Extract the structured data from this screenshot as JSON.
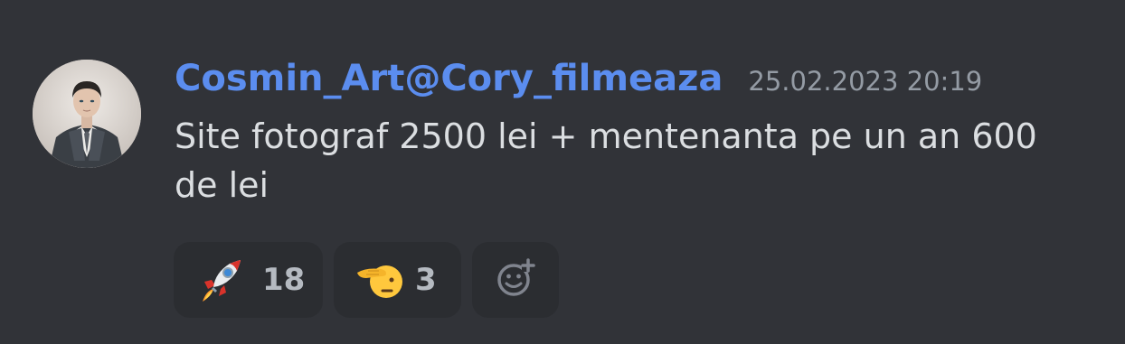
{
  "message": {
    "username": "Cosmin_Art@Cory_filmeaza",
    "timestamp": "25.02.2023 20:19",
    "content": "Site fotograf 2500 lei + mentenanta pe un an 600 de lei"
  },
  "reactions": [
    {
      "emoji": "rocket-emoji",
      "count": "18"
    },
    {
      "emoji": "saluting-face-emoji",
      "count": "3"
    }
  ],
  "add_reaction": {
    "icon": "add-reaction-icon"
  },
  "colors": {
    "background": "#313338",
    "username": "#5b8def",
    "timestamp": "#949ba4",
    "text": "#dbdee1",
    "reaction_bg": "#2b2d31"
  }
}
